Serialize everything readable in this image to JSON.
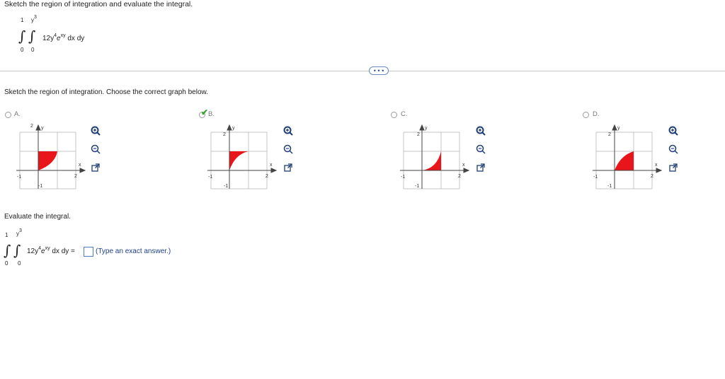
{
  "question": {
    "title": "Sketch the region of integration and evaluate the integral.",
    "integral": {
      "outer_upper": "1",
      "outer_lower": "0",
      "inner_upper_base": "y",
      "inner_upper_exp": "3",
      "inner_lower": "0",
      "integrand_coef": "12y",
      "integrand_exp1": "4",
      "integrand_e": "e",
      "integrand_exp2": "xy",
      "differentials": "dx dy"
    }
  },
  "more_button": {
    "label": "• • •"
  },
  "part1": {
    "instruction": "Sketch the region of integration. Choose the correct graph below.",
    "options": [
      {
        "letter": "A.",
        "selected": false
      },
      {
        "letter": "B.",
        "selected": true
      },
      {
        "letter": "C.",
        "selected": false
      },
      {
        "letter": "D.",
        "selected": false
      }
    ],
    "axis_labels": {
      "y": "y",
      "x": "x",
      "y_tick": "2",
      "x_tick": "2",
      "neg_x": "-1",
      "neg_y": "-1"
    },
    "check_mark": "✔",
    "fill_color": "#e8151b"
  },
  "part2": {
    "instruction": "Evaluate the integral.",
    "equals_text": "dx dy =",
    "hint": "(Type an exact answer.)"
  },
  "icons": {
    "zoom_in": "zoom-in-icon",
    "zoom_out": "zoom-out-icon",
    "external": "external-link-icon"
  }
}
